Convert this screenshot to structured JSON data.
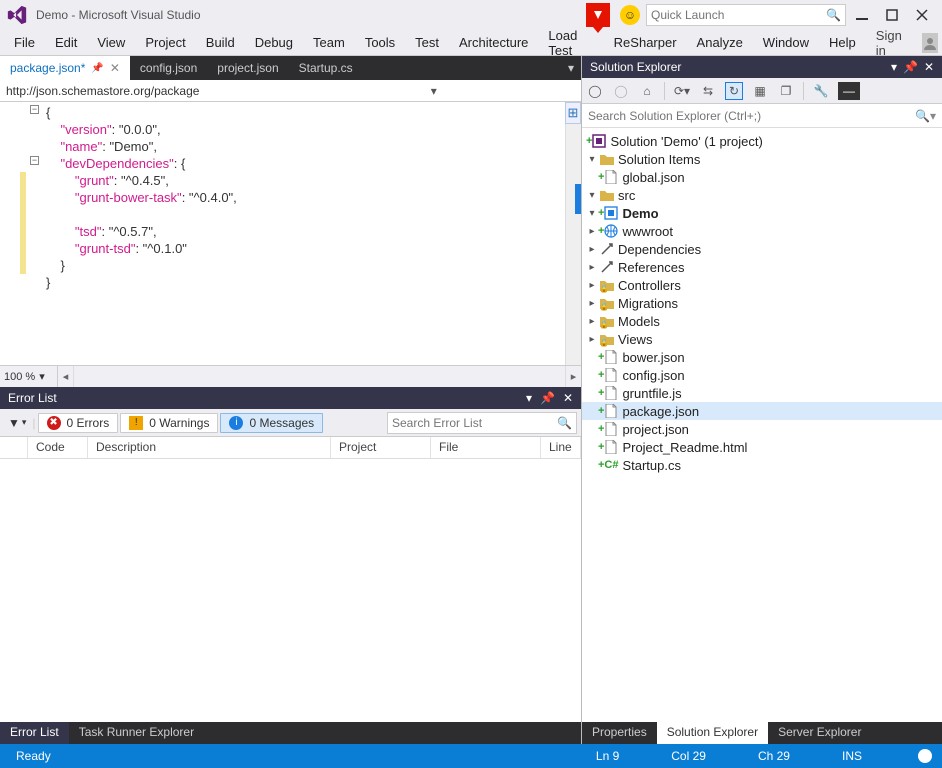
{
  "title": "Demo - Microsoft Visual Studio",
  "quicklaunch_placeholder": "Quick Launch",
  "menu": [
    "File",
    "Edit",
    "View",
    "Project",
    "Build",
    "Debug",
    "Team",
    "Tools",
    "Test",
    "Architecture",
    "Load Test",
    "ReSharper",
    "Analyze",
    "Window",
    "Help"
  ],
  "signin": "Sign in",
  "doc_tabs": [
    {
      "label": "package.json*",
      "active": true,
      "pinned": true
    },
    {
      "label": "config.json",
      "active": false
    },
    {
      "label": "project.json",
      "active": false
    },
    {
      "label": "Startup.cs",
      "active": false
    }
  ],
  "schema_url": "http://json.schemastore.org/package",
  "editor": {
    "zoom": "100 %",
    "lines": [
      "{",
      "    \"version\": \"0.0.0\",",
      "    \"name\": \"Demo\",",
      "    \"devDependencies\": {",
      "        \"grunt\": \"^0.4.5\",",
      "        \"grunt-bower-task\": \"^0.4.0\",",
      "",
      "        \"tsd\": \"^0.5.7\",",
      "        \"grunt-tsd\": \"^0.1.0\"",
      "    }",
      "}"
    ],
    "json": {
      "version": "0.0.0",
      "name": "Demo",
      "devDependencies": {
        "grunt": "^0.4.5",
        "grunt-bower-task": "^0.4.0",
        "tsd": "^0.5.7",
        "grunt-tsd": "^0.1.0"
      }
    }
  },
  "error_list": {
    "title": "Error List",
    "errors": "0 Errors",
    "warnings": "0 Warnings",
    "messages": "0 Messages",
    "search_placeholder": "Search Error List",
    "columns": [
      "",
      "Code",
      "Description",
      "Project",
      "File",
      "Line"
    ]
  },
  "bottom_tabs_left": [
    "Error List",
    "Task Runner Explorer"
  ],
  "solution_explorer": {
    "title": "Solution Explorer",
    "search_placeholder": "Search Solution Explorer (Ctrl+;)",
    "root": "Solution 'Demo' (1 project)",
    "tree": [
      {
        "d": 1,
        "tw": "▾",
        "ic": "folder",
        "label": "Solution Items"
      },
      {
        "d": 2,
        "tw": "",
        "ic": "json",
        "plus": true,
        "label": "global.json"
      },
      {
        "d": 1,
        "tw": "▾",
        "ic": "folder",
        "label": "src"
      },
      {
        "d": 2,
        "tw": "▾",
        "ic": "proj",
        "plus": true,
        "bold": true,
        "label": "Demo"
      },
      {
        "d": 3,
        "tw": "▸",
        "ic": "globe",
        "plus": true,
        "label": "wwwroot"
      },
      {
        "d": 3,
        "tw": "▸",
        "ic": "ref",
        "label": "Dependencies"
      },
      {
        "d": 3,
        "tw": "▸",
        "ic": "ref",
        "label": "References"
      },
      {
        "d": 3,
        "tw": "▸",
        "ic": "folder",
        "lock": true,
        "label": "Controllers"
      },
      {
        "d": 3,
        "tw": "▸",
        "ic": "folder",
        "lock": true,
        "label": "Migrations"
      },
      {
        "d": 3,
        "tw": "▸",
        "ic": "folder",
        "lock": true,
        "label": "Models"
      },
      {
        "d": 3,
        "tw": "▸",
        "ic": "folder",
        "lock": true,
        "label": "Views"
      },
      {
        "d": 3,
        "tw": "",
        "ic": "json",
        "plus": true,
        "label": "bower.json"
      },
      {
        "d": 3,
        "tw": "",
        "ic": "json",
        "plus": true,
        "label": "config.json"
      },
      {
        "d": 3,
        "tw": "",
        "ic": "js",
        "plus": true,
        "label": "gruntfile.js"
      },
      {
        "d": 3,
        "tw": "",
        "ic": "json",
        "plus": true,
        "sel": true,
        "label": "package.json"
      },
      {
        "d": 3,
        "tw": "",
        "ic": "json",
        "plus": true,
        "label": "project.json"
      },
      {
        "d": 3,
        "tw": "",
        "ic": "html",
        "plus": true,
        "label": "Project_Readme.html"
      },
      {
        "d": 3,
        "tw": "",
        "ic": "cs",
        "plus": true,
        "label": "Startup.cs"
      }
    ]
  },
  "bottom_tabs_right": [
    "Properties",
    "Solution Explorer",
    "Server Explorer"
  ],
  "status": {
    "ready": "Ready",
    "ln": "Ln 9",
    "col": "Col 29",
    "ch": "Ch 29",
    "ins": "INS"
  }
}
